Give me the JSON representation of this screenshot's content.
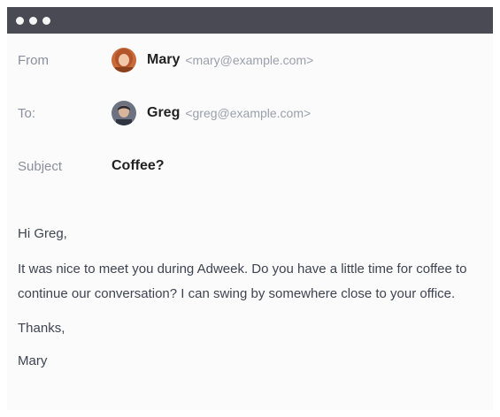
{
  "window": {
    "controls": [
      "close",
      "minimize",
      "maximize"
    ]
  },
  "header": {
    "from": {
      "label": "From",
      "name": "Mary",
      "email": "<mary@example.com>"
    },
    "to": {
      "label": "To:",
      "name": "Greg",
      "email": "<greg@example.com>"
    },
    "subject": {
      "label": "Subject",
      "value": "Coffee?"
    }
  },
  "body": {
    "greeting": "Hi Greg,",
    "paragraph": "It was nice to meet you during Adweek. Do you have a little time for coffee to continue our conversation? I can swing by somewhere close to your office.",
    "signoff": "Thanks,",
    "signature": "Mary"
  },
  "colors": {
    "titlebar": "#4a4a55",
    "label": "#8a8f9e",
    "email": "#9aa0ac",
    "body_text": "#3f4452"
  }
}
